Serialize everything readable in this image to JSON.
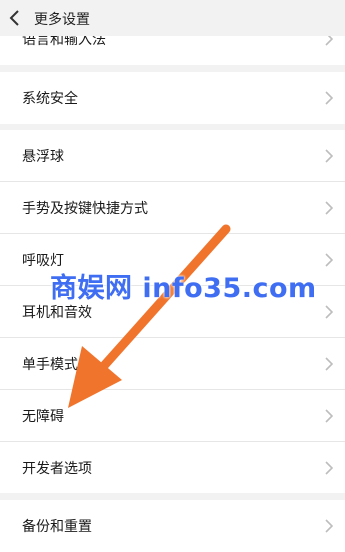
{
  "header": {
    "title": "更多设置"
  },
  "top_group": [
    {
      "label": "语言和输入法"
    }
  ],
  "system_group": [
    {
      "label": "系统安全"
    }
  ],
  "main_group": [
    {
      "label": "悬浮球"
    },
    {
      "label": "手势及按键快捷方式"
    },
    {
      "label": "呼吸灯"
    },
    {
      "label": "耳机和音效"
    },
    {
      "label": "单手模式"
    },
    {
      "label": "无障碍"
    },
    {
      "label": "开发者选项"
    }
  ],
  "bottom_group": [
    {
      "label": "备份和重置"
    }
  ],
  "watermark": {
    "text": "商娱网 info35.com"
  },
  "colors": {
    "background": "#f2f2f2",
    "row": "#ffffff",
    "arrow": "#f0742c",
    "watermark": "#3f6ef3"
  }
}
